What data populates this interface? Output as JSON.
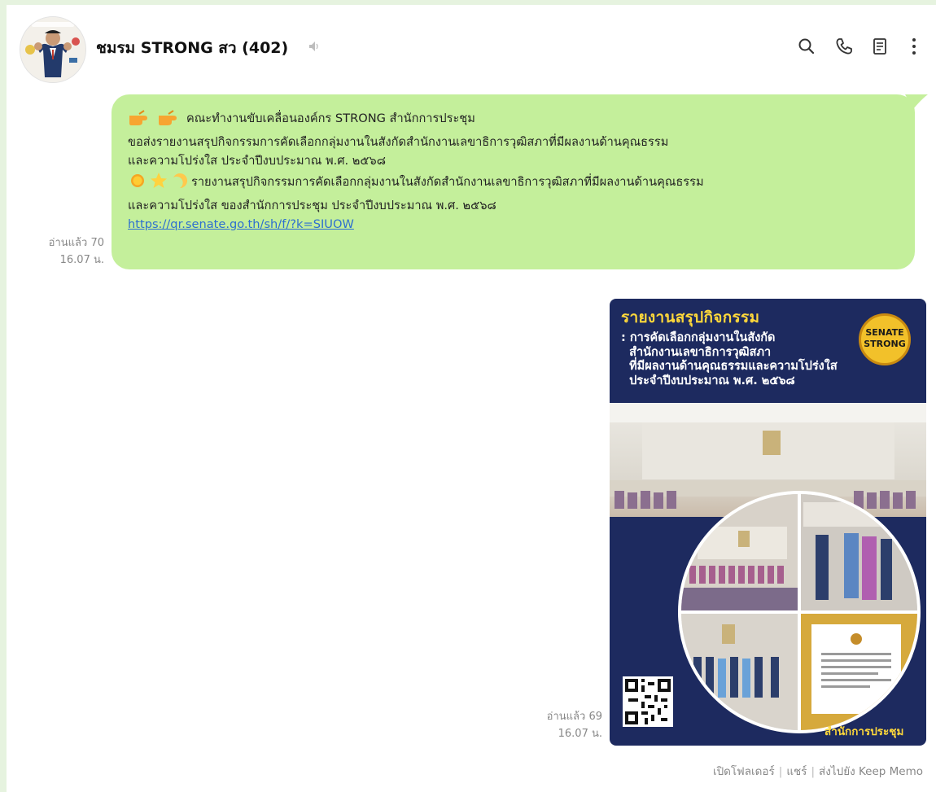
{
  "header": {
    "title": "ชมรม STRONG สว (402)",
    "icons": [
      "search-icon",
      "phone-icon",
      "notes-icon",
      "more-icon"
    ]
  },
  "message1": {
    "read_status": "อ่านแล้ว 70",
    "time": "16.07 น.",
    "line1": "คณะทำงานขับเคลื่อนองค์กร STRONG สำนักการประชุม",
    "line2": "ขอส่งรายงานสรุปกิจกรรมการคัดเลือกกลุ่มงานในสังกัดสำนักงานเลขาธิการวุฒิสภาที่มีผลงานด้านคุณธรรม",
    "line3": "และความโปร่งใส ประจำปีงบประมาณ พ.ศ. ๒๕๖๘",
    "line4": "รายงานสรุปกิจกรรมการคัดเลือกกลุ่มงานในสังกัดสำนักงานเลขาธิการวุฒิสภาที่มีผลงานด้านคุณธรรม",
    "line5": "และความโปร่งใส ของสำนักการประชุม ประจำปีงบประมาณ พ.ศ. ๒๕๖๘",
    "link": "https://qr.senate.go.th/sh/f/?k=SIUOW",
    "bubble_color": "#c4ef9b"
  },
  "message2": {
    "read_status": "อ่านแล้ว 69",
    "time": "16.07 น.",
    "poster": {
      "title": "รายงานสรุปกิจกรรม",
      "subtitle": ": การคัดเลือกกลุ่มงานในสังกัด\n  สำนักงานเลขาธิการวุฒิสภา\n  ที่มีผลงานด้านคุณธรรมและความโปร่งใส\n  ประจำปีงบประมาณ พ.ศ. ๒๕๖๘",
      "badge_top": "SENATE",
      "badge_bottom": "STRONG",
      "footer": "สำนักการประชุม"
    }
  },
  "actions": {
    "open_folder": "เปิดโฟลเดอร์",
    "share": "แชร์",
    "send_keep": "ส่งไปยัง Keep Memo"
  }
}
